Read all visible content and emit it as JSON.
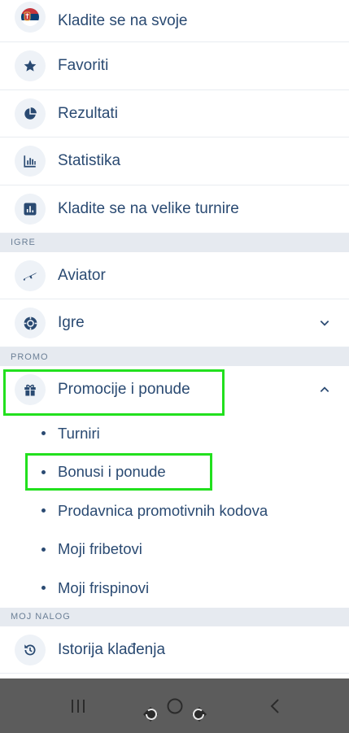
{
  "main_items": [
    {
      "label": "Kladite se na svoje",
      "icon": "serbia-flag-icon"
    },
    {
      "label": "Favoriti",
      "icon": "star-icon"
    },
    {
      "label": "Rezultati",
      "icon": "pie-chart-icon"
    },
    {
      "label": "Statistika",
      "icon": "bar-chart-icon"
    },
    {
      "label": "Kladite se na velike turnire",
      "icon": "stats-box-icon"
    }
  ],
  "sections": {
    "igre": "IGRE",
    "promo": "PROMO",
    "moj_nalog": "MOJ NALOG"
  },
  "igre_items": [
    {
      "label": "Aviator",
      "icon": "plane-icon"
    },
    {
      "label": "Igre",
      "icon": "chip-icon"
    }
  ],
  "promo": {
    "label": "Promocije i ponude",
    "icon": "gift-icon",
    "expanded": true,
    "sub_items": [
      {
        "label": "Turniri"
      },
      {
        "label": "Bonusi i ponude"
      },
      {
        "label": "Prodavnica promotivnih kodova"
      },
      {
        "label": "Moji fribetovi"
      },
      {
        "label": "Moji frispinovi"
      }
    ]
  },
  "account_items": [
    {
      "label": "Istorija klađenja",
      "icon": "history-icon"
    }
  ],
  "colors": {
    "accent_text": "#2a4a72",
    "icon_bg": "#eef2f7",
    "section_bg": "#e6eaf0",
    "highlight": "#22e01e",
    "nav_bar": "#5c5c5c"
  }
}
